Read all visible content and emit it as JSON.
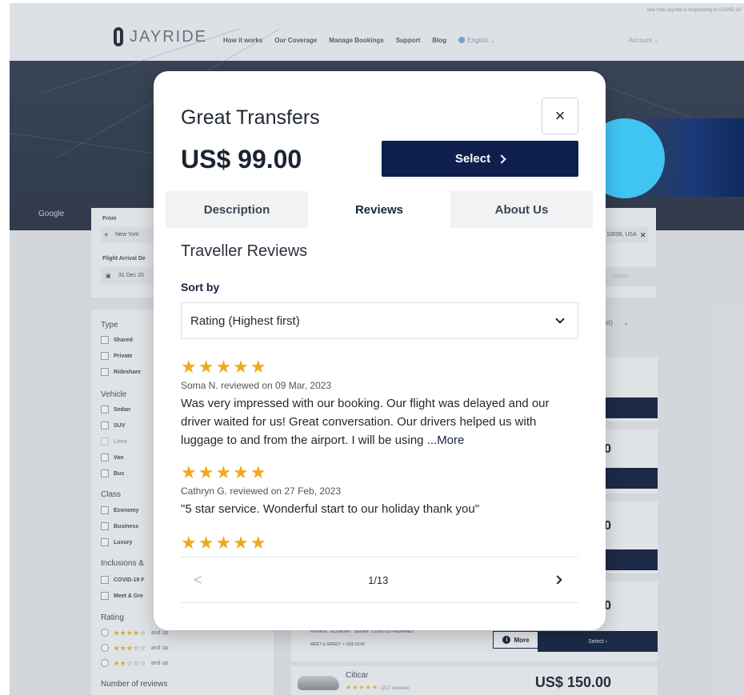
{
  "header": {
    "covid_notice": "See how Jayride is responding to COVID-19",
    "brand": "JAYRIDE",
    "nav": [
      "How it works",
      "Our Coverage",
      "Manage Bookings",
      "Support",
      "Blog"
    ],
    "language": "English",
    "account": "Account"
  },
  "map": {
    "attribution": "Google"
  },
  "search": {
    "from_label": "From",
    "from_value": "New York",
    "to_value": "10036, USA",
    "flight_label": "Flight Arrival De",
    "flight_value": "31 Dec 20",
    "update_label": "Update"
  },
  "filters": {
    "type_label": "Type",
    "type_items": [
      "Shared",
      "Private",
      "Rideshare"
    ],
    "vehicle_label": "Vehicle",
    "vehicle_items": [
      "Sedan",
      "SUV",
      "Limo",
      "Van",
      "Bus"
    ],
    "class_label": "Class",
    "class_items": [
      "Economy",
      "Business",
      "Luxury"
    ],
    "inclusions_label": "Inclusions &",
    "inclusions_items": [
      "COVID-19 F",
      "Meet & Gre"
    ],
    "rating_label": "Rating",
    "rating_options": [
      {
        "stars": 4,
        "suffix": "and up"
      },
      {
        "stars": 3,
        "suffix": "and up"
      },
      {
        "stars": 2,
        "suffix": "and up"
      }
    ],
    "reviews_count_label": "Number of reviews"
  },
  "results": {
    "sort_value": "pest)",
    "cards": [
      {
        "price": "0",
        "select_label": "Select"
      },
      {
        "price": "0",
        "select_label": "Select"
      },
      {
        "price": "0",
        "select_label": "Select"
      }
    ],
    "tags": [
      "PRIVATE",
      "ECONOMY",
      "SEDAN",
      "COVID-19 PREPARED"
    ],
    "meet_tag": "MEET & GREET: + US$ 15.00",
    "more_label": "More",
    "select_label": "Select",
    "citicar": {
      "name": "Citicar",
      "reviews": "(217 reviews)",
      "price": "US$ 150.00"
    }
  },
  "modal": {
    "title": "Great Transfers",
    "price": "US$ 99.00",
    "close_symbol": "×",
    "select_label": "Select",
    "tabs": [
      {
        "label": "Description",
        "active": false
      },
      {
        "label": "Reviews",
        "active": true
      },
      {
        "label": "About Us",
        "active": false
      }
    ],
    "section_title": "Traveller Reviews",
    "sort_label": "Sort by",
    "sort_value": "Rating (Highest first)",
    "reviews": [
      {
        "stars": "★★★★★",
        "rating": 5,
        "meta": "Soma N. reviewed on 09 Mar, 2023",
        "text": "Was very impressed with our booking. Our flight was delayed and our driver waited for us! Great conversation. Our drivers helped us with luggage to and from the airport. I will be using ",
        "more": "...More"
      },
      {
        "stars": "★★★★★",
        "rating": 5,
        "meta": "Cathryn G. reviewed on 27 Feb, 2023",
        "text": "\"5 star service. Wonderful start to our holiday thank you\"",
        "more": ""
      },
      {
        "stars": "★★★★★",
        "rating": 5,
        "meta": "",
        "text": "",
        "more": ""
      }
    ],
    "pager": {
      "prev": "<",
      "text": "1/13"
    }
  },
  "colors": {
    "primary": "#0f1f4d",
    "star": "#f2a81b",
    "accent_blob": "#40c4f2"
  }
}
